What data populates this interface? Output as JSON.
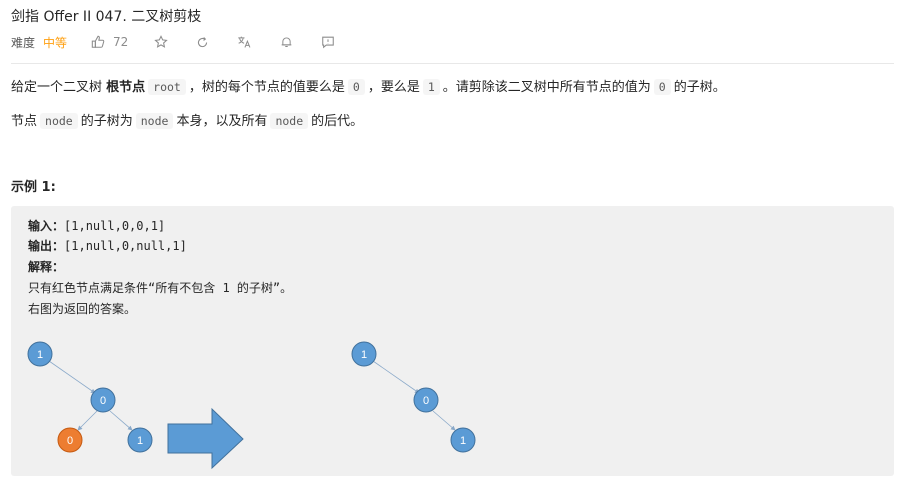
{
  "problem": {
    "title": "剑指 Offer II 047. 二叉树剪枝",
    "difficulty_label": "难度",
    "difficulty": "中等",
    "likes": "72"
  },
  "icons": {
    "like": "thumbs-up-icon",
    "star": "star-icon",
    "share": "refresh-share-icon",
    "translate": "translate-icon",
    "bell": "bell-icon",
    "feedback": "feedback-icon"
  },
  "description": {
    "p1": {
      "t1": "给定一个二叉树 ",
      "bold": "根节点",
      "c1": "root",
      "t2": "，树的每个节点的值要么是",
      "c2": "0",
      "t3": "，要么是",
      "c3": "1",
      "t4": "。请剪除该二叉树中所有节点的值为",
      "c4": "0",
      "t5": "的子树。"
    },
    "p2": {
      "t1": "节点",
      "c1": "node",
      "t2": "的子树为",
      "c2": "node",
      "t3": "本身，以及所有",
      "c3": "node",
      "t4": "的后代。"
    }
  },
  "example": {
    "heading": "示例 1:",
    "input_label": "输入：",
    "input_value": "[1,null,0,0,1]",
    "output_label": "输出：",
    "output_value": "[1,null,0,null,1]",
    "explain_label": "解释：",
    "explain_1": "只有红色节点满足条件“所有不包含 1 的子树”。",
    "explain_2": "右图为返回的答案。",
    "left_tree": {
      "root": "1",
      "mid": "0",
      "leaf_left": "0",
      "leaf_right": "1"
    },
    "right_tree": {
      "root": "1",
      "mid": "0",
      "leaf": "1"
    }
  },
  "colors": {
    "node_blue": "#5b9bd5",
    "node_orange": "#ed7d31",
    "arrow_blue": "#5b9bd5",
    "difficulty": "#ff9f0f"
  }
}
